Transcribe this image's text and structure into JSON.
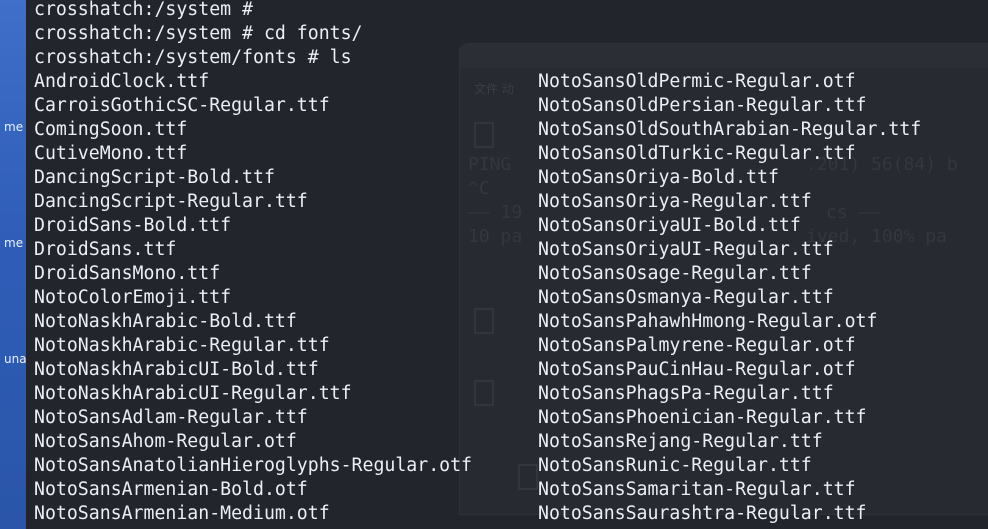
{
  "desktop": {
    "labels": [
      "me",
      "me",
      "una"
    ]
  },
  "ghost_window": {
    "menu": "文件  动",
    "lines": [
      "PING",
      "^C",
      "—— 19",
      "10 pa"
    ],
    "right_fragments": [
      ".201) 56(84) b",
      "cs ——",
      "ived, 100% pa"
    ]
  },
  "terminal": {
    "prompt_lines": [
      "crosshatch:/system #",
      "crosshatch:/system # cd fonts/",
      "crosshatch:/system/fonts # ls"
    ],
    "files_col1": [
      "AndroidClock.ttf",
      "CarroisGothicSC-Regular.ttf",
      "ComingSoon.ttf",
      "CutiveMono.ttf",
      "DancingScript-Bold.ttf",
      "DancingScript-Regular.ttf",
      "DroidSans-Bold.ttf",
      "DroidSans.ttf",
      "DroidSansMono.ttf",
      "NotoColorEmoji.ttf",
      "NotoNaskhArabic-Bold.ttf",
      "NotoNaskhArabic-Regular.ttf",
      "NotoNaskhArabicUI-Bold.ttf",
      "NotoNaskhArabicUI-Regular.ttf",
      "NotoSansAdlam-Regular.ttf",
      "NotoSansAhom-Regular.otf",
      "NotoSansAnatolianHieroglyphs-Regular.otf",
      "NotoSansArmenian-Bold.otf",
      "NotoSansArmenian-Medium.otf"
    ],
    "files_col2": [
      "NotoSansOldPermic-Regular.otf",
      "NotoSansOldPersian-Regular.ttf",
      "NotoSansOldSouthArabian-Regular.ttf",
      "NotoSansOldTurkic-Regular.ttf",
      "NotoSansOriya-Bold.ttf",
      "NotoSansOriya-Regular.ttf",
      "NotoSansOriyaUI-Bold.ttf",
      "NotoSansOriyaUI-Regular.ttf",
      "NotoSansOsage-Regular.ttf",
      "NotoSansOsmanya-Regular.ttf",
      "NotoSansPahawhHmong-Regular.otf",
      "NotoSansPalmyrene-Regular.otf",
      "NotoSansPauCinHau-Regular.otf",
      "NotoSansPhagsPa-Regular.ttf",
      "NotoSansPhoenician-Regular.ttf",
      "NotoSansRejang-Regular.ttf",
      "NotoSansRunic-Regular.ttf",
      "NotoSansSamaritan-Regular.ttf",
      "NotoSansSaurashtra-Regular.ttf"
    ]
  }
}
